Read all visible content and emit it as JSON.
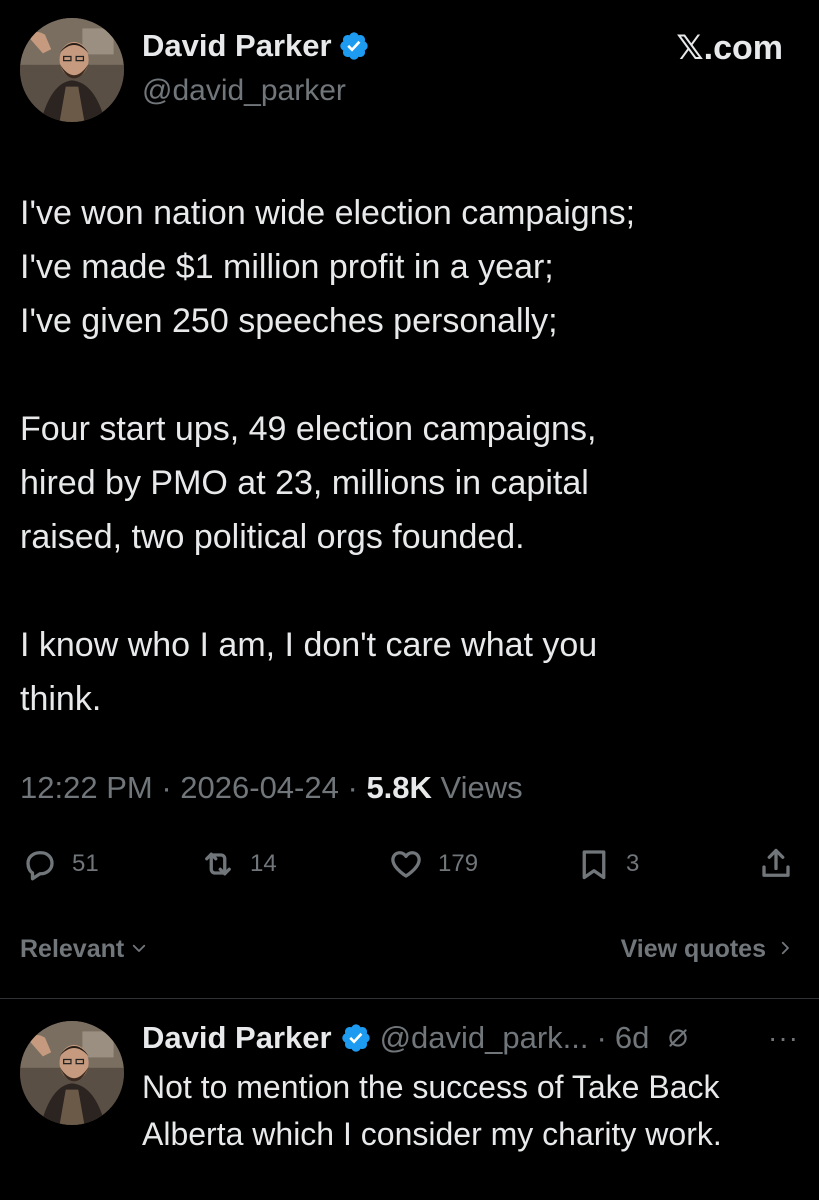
{
  "brand": {
    "site": "𝕏.com"
  },
  "tweet": {
    "author_name": "David Parker",
    "handle": "@david_parker",
    "body": [
      "I've won nation wide election campaigns;",
      "I've made $1 million profit in a year;",
      "I've given 250 speeches personally;",
      "",
      "Four start ups, 49 election campaigns,",
      "hired by PMO at 23, millions in capital",
      "raised, two political orgs founded.",
      "",
      "I know who I am, I don't care what you",
      "think."
    ],
    "time": "12:22 PM",
    "date": "2026-04-24",
    "separator": "·",
    "views_count": "5.8K",
    "views_label": "Views",
    "actions": {
      "replies": "51",
      "reposts": "14",
      "likes": "179",
      "bookmarks": "3"
    }
  },
  "filter": {
    "sort_label": "Relevant",
    "view_quotes_label": "View quotes"
  },
  "reply": {
    "author_name": "David Parker",
    "handle": "@david_park...",
    "separator": "·",
    "age": "6d",
    "more": "···",
    "text": "Not to mention the success of Take Back Alberta which I consider my charity work."
  },
  "colors": {
    "background": "#000000",
    "text": "#e7e9ea",
    "muted": "#71767b",
    "verified": "#1d9bf0",
    "divider": "#2f3336"
  },
  "icons": [
    "verified-badge-icon",
    "reply-icon",
    "repost-icon",
    "like-icon",
    "bookmark-icon",
    "share-icon",
    "chevron-down-icon",
    "chevron-right-icon",
    "grok-icon"
  ]
}
